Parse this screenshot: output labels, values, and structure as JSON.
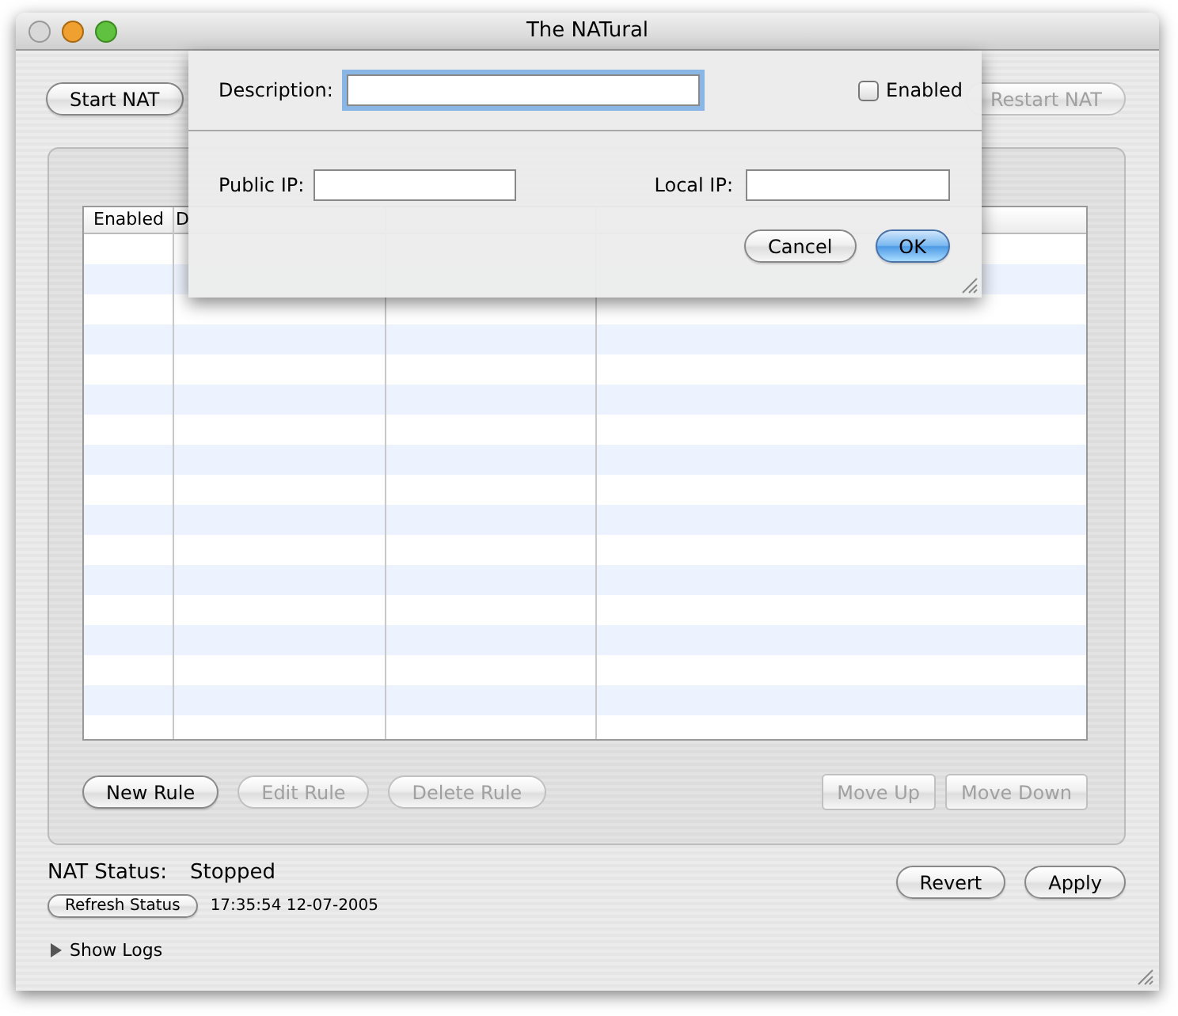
{
  "window": {
    "title": "The NATural"
  },
  "toolbar": {
    "buttons": [
      {
        "label": "Start NAT",
        "disabled": false
      },
      {
        "label": "Restart NAT",
        "disabled": true
      }
    ]
  },
  "table": {
    "columns": [
      "Enabled",
      "D"
    ]
  },
  "rule_buttons": [
    {
      "label": "New Rule",
      "kind": "round",
      "disabled": false
    },
    {
      "label": "Edit Rule",
      "kind": "round",
      "disabled": true
    },
    {
      "label": "Delete Rule",
      "kind": "round",
      "disabled": true
    },
    {
      "label": "Move Up",
      "kind": "square",
      "disabled": true
    },
    {
      "label": "Move Down",
      "kind": "square",
      "disabled": true
    }
  ],
  "status": {
    "label": "NAT Status:",
    "value": "Stopped",
    "refresh_button": "Refresh Status",
    "timestamp": "17:35:54 12-07-2005"
  },
  "footer_buttons": [
    {
      "label": "Revert"
    },
    {
      "label": "Apply"
    }
  ],
  "show_logs": {
    "label": "Show Logs",
    "expanded": false
  },
  "sheet": {
    "description_label": "Description:",
    "description_focused": true,
    "enabled": {
      "label": "Enabled",
      "checked": false
    },
    "public_ip_label": "Public IP:",
    "local_ip_label": "Local IP:",
    "buttons": [
      {
        "label": "Cancel",
        "default": false
      },
      {
        "label": "OK",
        "default": true
      }
    ]
  }
}
